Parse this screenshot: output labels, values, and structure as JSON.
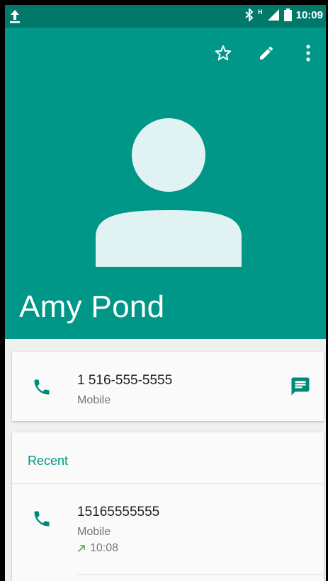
{
  "status_bar": {
    "network_badge": "H",
    "time": "10:09",
    "icons": [
      "upload-icon",
      "bluetooth-icon",
      "signal-icon",
      "battery-icon"
    ]
  },
  "toolbar": {
    "icons": [
      "star-outline-icon",
      "edit-icon",
      "more-vert-icon"
    ]
  },
  "contact": {
    "name": "Amy Pond",
    "phone": {
      "number": "1 516-555-5555",
      "type": "Mobile"
    }
  },
  "recent": {
    "title": "Recent",
    "items": [
      {
        "number": "15165555555",
        "type": "Mobile",
        "time": "10:08",
        "direction": "outgoing"
      }
    ]
  },
  "colors": {
    "header": "#009688",
    "status_bar": "#00796b",
    "accent": "#009688",
    "outgoing_arrow": "#4caf50"
  }
}
